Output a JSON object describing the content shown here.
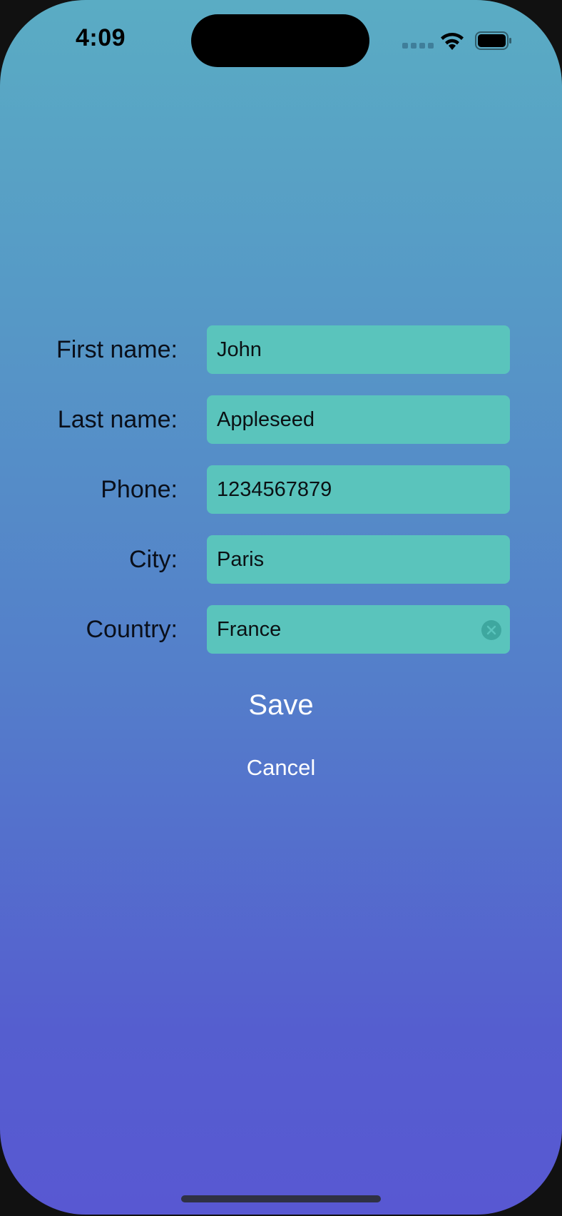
{
  "status_bar": {
    "time": "4:09"
  },
  "form": {
    "fields": [
      {
        "label": "First name:",
        "value": "John"
      },
      {
        "label": "Last name:",
        "value": "Appleseed"
      },
      {
        "label": "Phone:",
        "value": "1234567879"
      },
      {
        "label": "City:",
        "value": "Paris"
      },
      {
        "label": "Country:",
        "value": "France"
      }
    ]
  },
  "actions": {
    "save_label": "Save",
    "cancel_label": "Cancel"
  },
  "colors": {
    "gradient_top": "#5aacc4",
    "gradient_bottom": "#5858d2",
    "field_background": "#5ac4bc",
    "button_text": "#ffffff"
  }
}
